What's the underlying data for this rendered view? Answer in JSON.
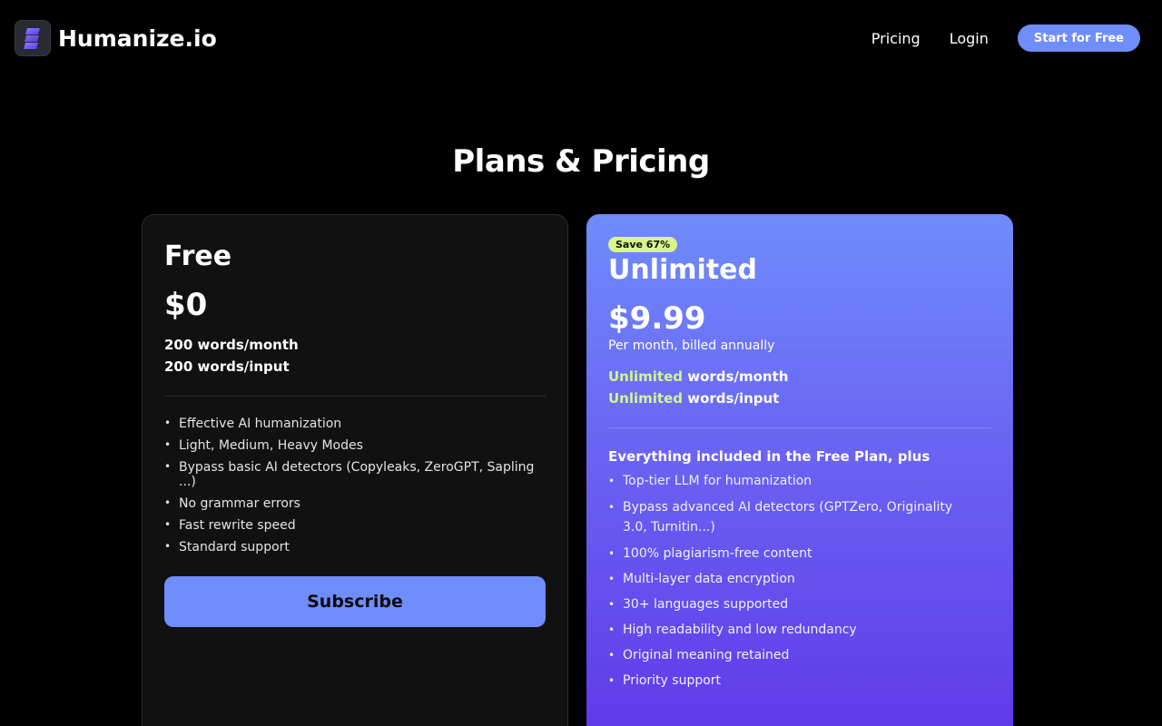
{
  "nav": {
    "brand": "Humanize.io",
    "links": [
      "Pricing",
      "Login"
    ],
    "cta": "Start for Free"
  },
  "page": {
    "title": "Plans & Pricing"
  },
  "plans": {
    "free": {
      "name": "Free",
      "price": "$0",
      "limits": [
        "200 words/month",
        "200 words/input"
      ],
      "features": [
        "Effective AI humanization",
        "Light, Medium, Heavy Modes",
        "Bypass basic AI detectors (Copyleaks, ZeroGPT, Sapling ...)",
        "No grammar errors",
        "Fast rewrite speed",
        "Standard support"
      ],
      "button": "Subscribe"
    },
    "unlimited": {
      "badge": "Save 67%",
      "name": "Unlimited",
      "price": "$9.99",
      "billing": "Per month, billed annually",
      "limit_highlight": "Unlimited",
      "limits": [
        "words/month",
        "words/input"
      ],
      "features_heading": "Everything included in the Free Plan, plus",
      "features": [
        "Top-tier LLM for humanization",
        "Bypass advanced AI detectors (GPTZero, Originality 3.0, Turnitin...)",
        "100% plagiarism-free content",
        "Multi-layer data encryption",
        "30+ languages supported",
        "High readability and low redundancy",
        "Original meaning retained",
        "Priority support"
      ]
    }
  },
  "colors": {
    "accent": "#6f8dfb",
    "highlight": "#d4f58f",
    "background": "#000000"
  },
  "icons": {
    "brand": "brand-logo-icon"
  }
}
